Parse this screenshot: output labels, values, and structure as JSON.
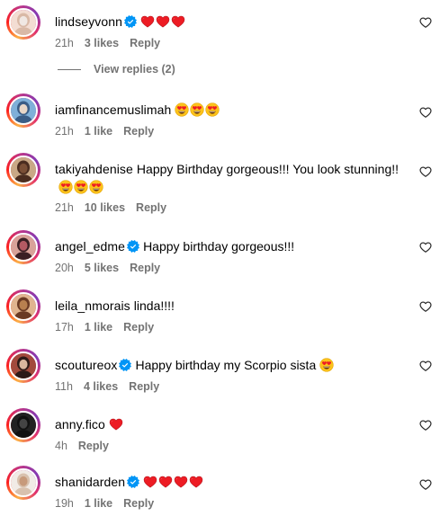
{
  "comments": [
    {
      "username": "lindseyvonn",
      "verified": true,
      "text": "",
      "emojis": [
        "heart",
        "heart",
        "heart"
      ],
      "time": "21h",
      "likes": "3 likes",
      "reply": "Reply",
      "avatar": "avatar-lindseyvonn",
      "story_ring": true
    },
    {
      "username": "iamfinancemuslimah",
      "verified": false,
      "text": "",
      "emojis": [
        "heart-eyes",
        "heart-eyes",
        "heart-eyes"
      ],
      "time": "21h",
      "likes": "1 like",
      "reply": "Reply",
      "avatar": "avatar-iamfinancemuslimah",
      "story_ring": true
    },
    {
      "username": "takiyahdenise",
      "verified": false,
      "text": "Happy Birthday gorgeous!!! You look stunning!!",
      "emojis": [
        "heart-eyes",
        "heart-eyes",
        "heart-eyes"
      ],
      "time": "21h",
      "likes": "10 likes",
      "reply": "Reply",
      "avatar": "avatar-takiyahdenise",
      "story_ring": true
    },
    {
      "username": "angel_edme",
      "verified": true,
      "text": "Happy birthday gorgeous!!!",
      "emojis": [],
      "time": "20h",
      "likes": "5 likes",
      "reply": "Reply",
      "avatar": "avatar-angel-edme",
      "story_ring": true
    },
    {
      "username": "leila_nmorais",
      "verified": false,
      "text": "linda!!!!",
      "emojis": [],
      "time": "17h",
      "likes": "1 like",
      "reply": "Reply",
      "avatar": "avatar-leila-nmorais",
      "story_ring": true
    },
    {
      "username": "scoutureox",
      "verified": true,
      "text": "Happy birthday my Scorpio sista",
      "emojis": [
        "heart-eyes"
      ],
      "time": "11h",
      "likes": "4 likes",
      "reply": "Reply",
      "avatar": "avatar-scoutureox",
      "story_ring": true
    },
    {
      "username": "anny.fico",
      "verified": false,
      "text": "",
      "emojis": [
        "heart"
      ],
      "time": "4h",
      "likes": "",
      "reply": "Reply",
      "avatar": "avatar-anny-fico",
      "story_ring": true
    },
    {
      "username": "shanidarden",
      "verified": true,
      "text": "",
      "emojis": [
        "heart",
        "heart",
        "heart",
        "heart"
      ],
      "time": "19h",
      "likes": "1 like",
      "reply": "Reply",
      "avatar": "avatar-shanidarden",
      "story_ring": true
    }
  ],
  "view_replies": "View replies (2)",
  "colors": {
    "meta_text": "#737373",
    "verified_blue": "#0095f6",
    "heart_red": "#ed1c24"
  },
  "icons": {
    "like": "heart-outline-icon",
    "verified": "verified-badge-icon",
    "emoji_heart": "red-heart-emoji",
    "emoji_heart_eyes": "heart-eyes-emoji"
  }
}
